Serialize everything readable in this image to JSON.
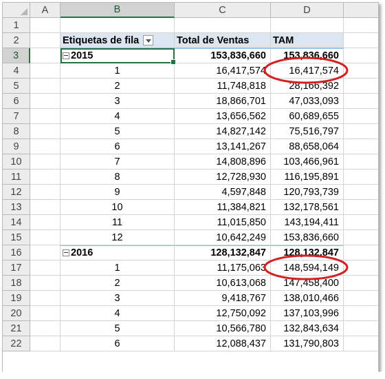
{
  "columns": [
    "",
    "A",
    "B",
    "C",
    "D",
    ""
  ],
  "pivot": {
    "header_labels": "Etiquetas de fila",
    "header_total": "Total de Ventas",
    "header_tam": "TAM"
  },
  "rows": [
    {
      "n": "1",
      "b": "",
      "c": "",
      "d": "",
      "type": "blank"
    },
    {
      "n": "2",
      "b": "",
      "c": "",
      "d": "",
      "type": "header"
    },
    {
      "n": "3",
      "b": "2015",
      "c": "153,836,660",
      "d": "153,836,660",
      "type": "year"
    },
    {
      "n": "4",
      "b": "1",
      "c": "16,417,574",
      "d": "16,417,574",
      "type": "item"
    },
    {
      "n": "5",
      "b": "2",
      "c": "11,748,818",
      "d": "28,166,392",
      "type": "item"
    },
    {
      "n": "6",
      "b": "3",
      "c": "18,866,701",
      "d": "47,033,093",
      "type": "item"
    },
    {
      "n": "7",
      "b": "4",
      "c": "13,656,562",
      "d": "60,689,655",
      "type": "item"
    },
    {
      "n": "8",
      "b": "5",
      "c": "14,827,142",
      "d": "75,516,797",
      "type": "item"
    },
    {
      "n": "9",
      "b": "6",
      "c": "13,141,267",
      "d": "88,658,064",
      "type": "item"
    },
    {
      "n": "10",
      "b": "7",
      "c": "14,808,896",
      "d": "103,466,961",
      "type": "item"
    },
    {
      "n": "11",
      "b": "8",
      "c": "12,728,930",
      "d": "116,195,891",
      "type": "item"
    },
    {
      "n": "12",
      "b": "9",
      "c": "4,597,848",
      "d": "120,793,739",
      "type": "item"
    },
    {
      "n": "13",
      "b": "10",
      "c": "11,384,821",
      "d": "132,178,561",
      "type": "item"
    },
    {
      "n": "14",
      "b": "11",
      "c": "11,015,850",
      "d": "143,194,411",
      "type": "item"
    },
    {
      "n": "15",
      "b": "12",
      "c": "10,642,249",
      "d": "153,836,660",
      "type": "item"
    },
    {
      "n": "16",
      "b": "2016",
      "c": "128,132,847",
      "d": "128,132,847",
      "type": "year"
    },
    {
      "n": "17",
      "b": "1",
      "c": "11,175,063",
      "d": "148,594,149",
      "type": "item"
    },
    {
      "n": "18",
      "b": "2",
      "c": "10,613,068",
      "d": "147,458,400",
      "type": "item"
    },
    {
      "n": "19",
      "b": "3",
      "c": "9,418,767",
      "d": "138,010,466",
      "type": "item"
    },
    {
      "n": "20",
      "b": "4",
      "c": "12,750,092",
      "d": "137,103,996",
      "type": "item"
    },
    {
      "n": "21",
      "b": "5",
      "c": "10,566,780",
      "d": "132,843,634",
      "type": "item"
    },
    {
      "n": "22",
      "b": "6",
      "c": "12,088,437",
      "d": "131,790,803",
      "type": "item"
    }
  ],
  "colors": {
    "highlight_circle": "#d42020",
    "selection": "#217346",
    "pivot_header": "#dce6f1"
  }
}
